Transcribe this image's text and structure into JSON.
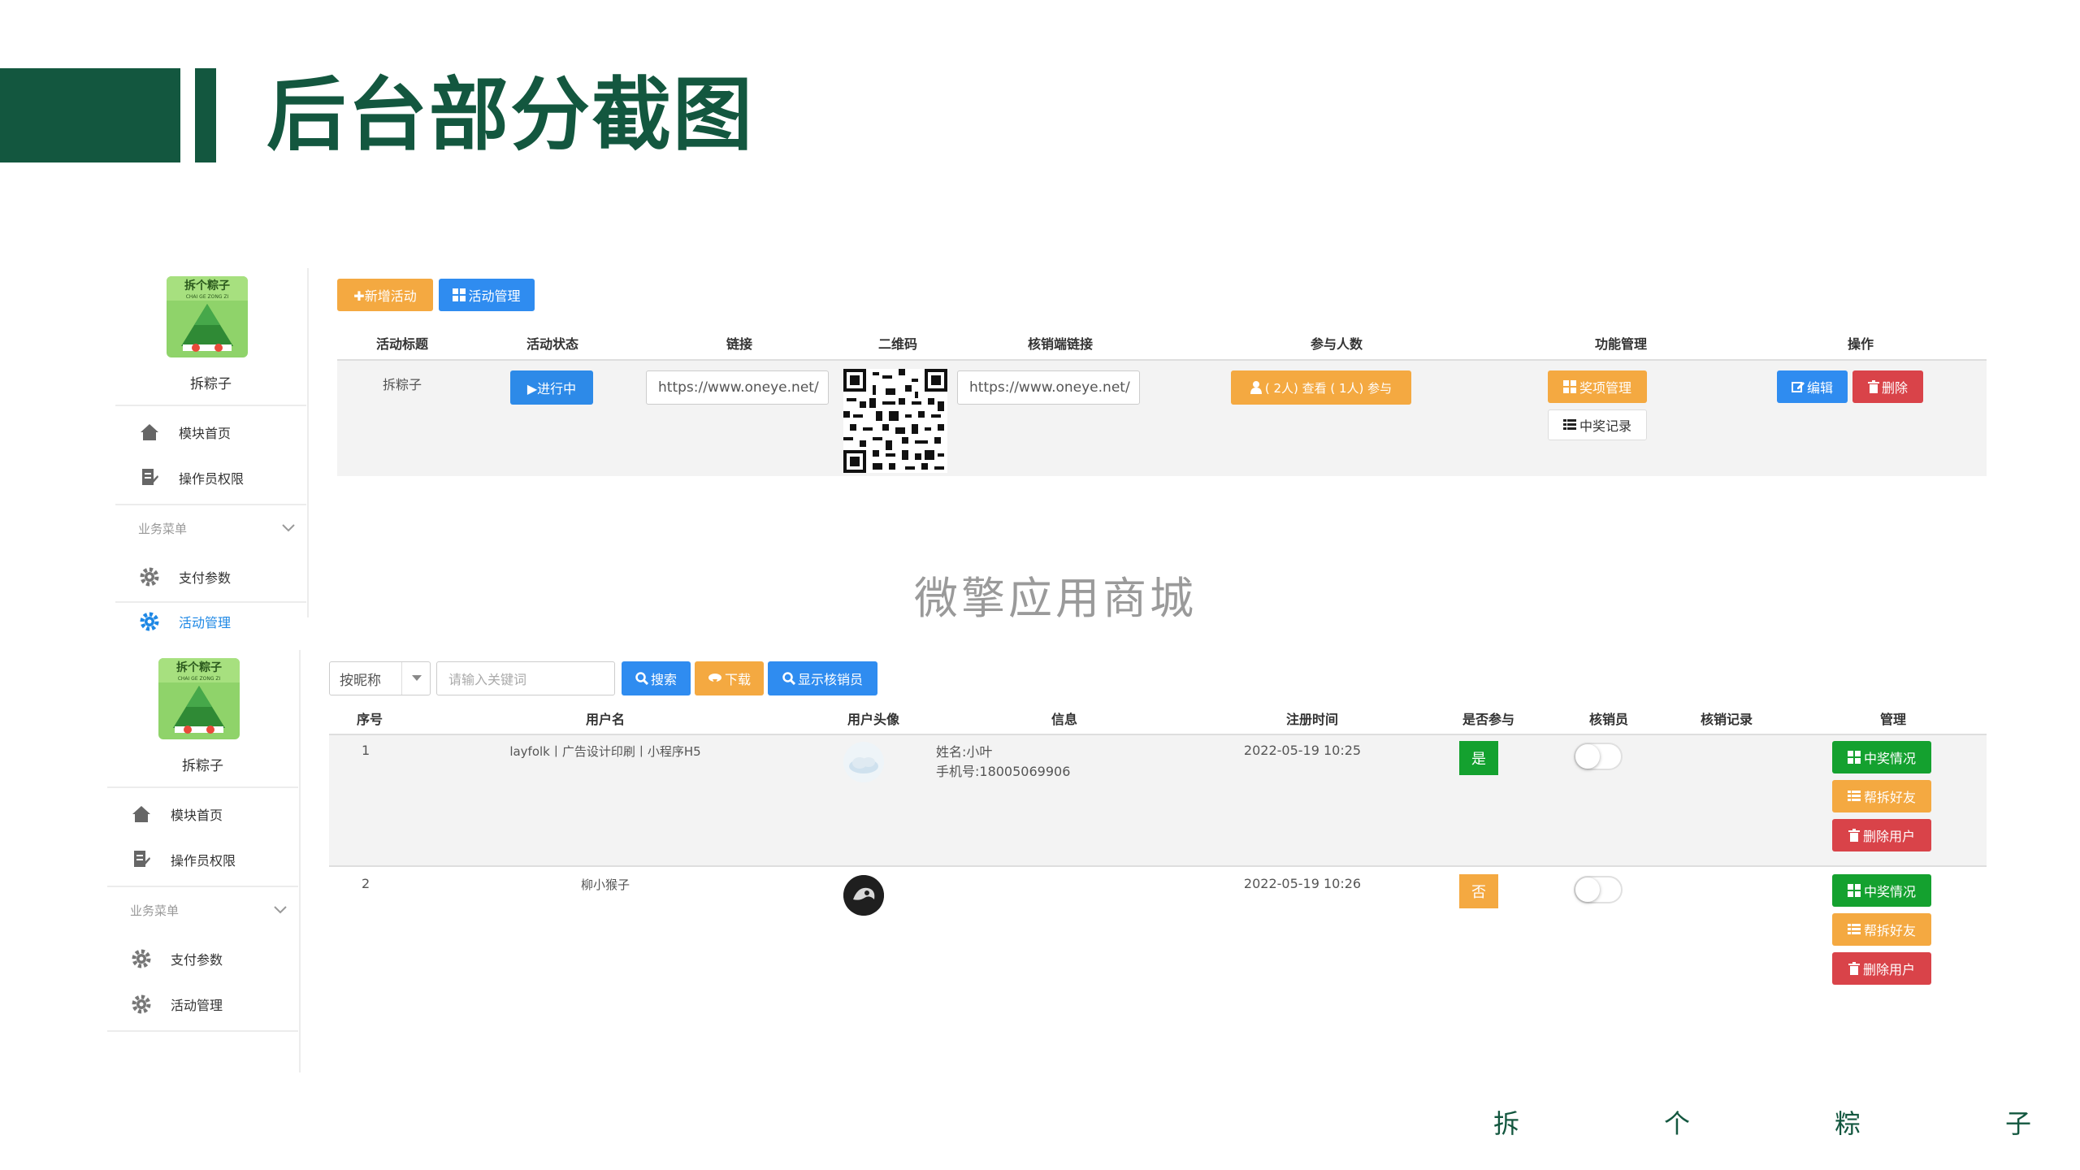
{
  "page": {
    "title": "后台部分截图"
  },
  "sidebar": {
    "app_name": "拆粽子",
    "logo_text": "拆个粽子",
    "logo_subtext": "CHAI GE ZONG ZI",
    "items": [
      {
        "label": "模块首页",
        "icon": "home-icon"
      },
      {
        "label": "操作员权限",
        "icon": "document-edit-icon"
      }
    ],
    "group_label": "业务菜单",
    "group_items": [
      {
        "label": "支付参数",
        "icon": "gear-icon"
      },
      {
        "label": "活动管理",
        "icon": "gear-icon"
      }
    ]
  },
  "activity": {
    "toolbar": {
      "add_label": "✚新增活动",
      "manage_label": "活动管理"
    },
    "columns": [
      "活动标题",
      "活动状态",
      "链接",
      "二维码",
      "核销端链接",
      "参与人数",
      "功能管理",
      "操作"
    ],
    "row": {
      "title": "拆粽子",
      "status": "▶进行中",
      "link": "https://www.oneye.net/",
      "verify_link": "https://www.oneye.net/",
      "participants": "( 2人) 查看 ( 1人) 参与",
      "prize_manage": "奖项管理",
      "win_records": "中奖记录",
      "edit": "编辑",
      "delete": "删除"
    }
  },
  "watermark": "微擎应用商城",
  "users": {
    "filter": {
      "select_value": "按昵称",
      "search_placeholder": "请输入关键词",
      "search_label": "搜索",
      "download_label": "下载",
      "show_verifier_label": "显示核销员"
    },
    "columns": [
      "序号",
      "用户名",
      "用户头像",
      "信息",
      "注册时间",
      "是否参与",
      "核销员",
      "核销记录",
      "管理"
    ],
    "rows": [
      {
        "index": "1",
        "username": "layfolk丨广告设计印刷丨小程序H5",
        "info_name": "姓名:小叶",
        "info_phone": "手机号:18005069906",
        "registered": "2022-05-19 10:25",
        "participated": "是"
      },
      {
        "index": "2",
        "username": "柳小猴子",
        "info_name": "",
        "info_phone": "",
        "registered": "2022-05-19 10:26",
        "participated": "否"
      }
    ],
    "actions": {
      "win_status": "中奖情况",
      "help_friends": "帮拆好友",
      "delete_user": "删除用户"
    }
  },
  "footer": {
    "chars": [
      "拆",
      "个",
      "粽",
      "子"
    ]
  },
  "colors": {
    "brand_green": "#13573f",
    "orange": "#f4a941",
    "blue": "#2f8cf0",
    "red": "#d94349",
    "green": "#14a12f"
  }
}
